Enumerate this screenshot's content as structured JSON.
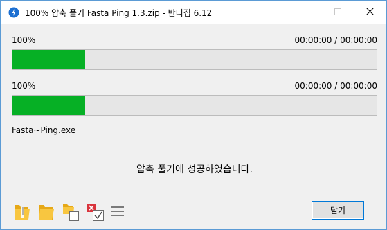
{
  "window": {
    "title": "100% 압축 풀기 Fasta Ping 1.3.zip - 반디집 6.12",
    "app_icon": "bandizip-icon",
    "controls": [
      "minimize-icon",
      "maximize-icon",
      "close-icon"
    ]
  },
  "progress": [
    {
      "percent_label": "100%",
      "time": "00:00:00 / 00:00:00",
      "fill_fraction": 0.2
    },
    {
      "percent_label": "100%",
      "time": "00:00:00 / 00:00:00",
      "fill_fraction": 0.2
    }
  ],
  "current_file": "Fasta~Ping.exe",
  "message": "압축 풀기에 성공하였습니다.",
  "toolbar": {
    "icons": [
      "zip-folder-icon",
      "open-folder-icon",
      "copy-files-icon",
      "delete-archive-icon",
      "menu-icon"
    ]
  },
  "close_button_label": "닫기",
  "colors": {
    "progress_fill": "#06b025",
    "accent": "#0078d7"
  }
}
